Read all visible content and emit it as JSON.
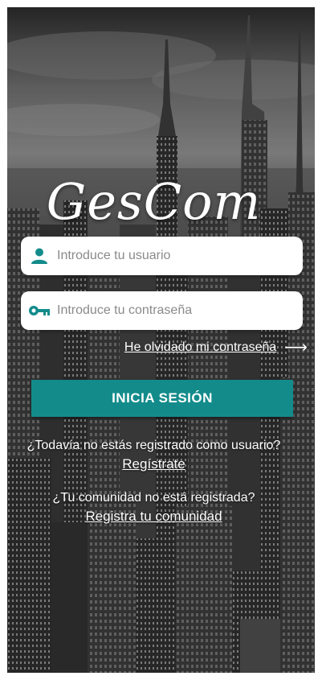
{
  "app": {
    "logo_text": "GesCom"
  },
  "login": {
    "username_placeholder": "Introduce tu usuario",
    "password_placeholder": "Introduce tu contraseña",
    "forgot_password": "He olvidado mi contraseña",
    "submit_label": "INICIA SESIÓN"
  },
  "register": {
    "user_question": "¿Todavía no estás registrado como usuario?",
    "user_link": "Regístrate",
    "community_question": "¿Tu comunidad no está registrada?",
    "community_link": "Registra tu comunidad"
  },
  "colors": {
    "accent": "#138b8b",
    "icon": "#138b8b",
    "text_light": "#ffffff"
  },
  "icons": {
    "username": "person-icon",
    "password": "key-icon",
    "forgot": "arrow-right-icon"
  }
}
